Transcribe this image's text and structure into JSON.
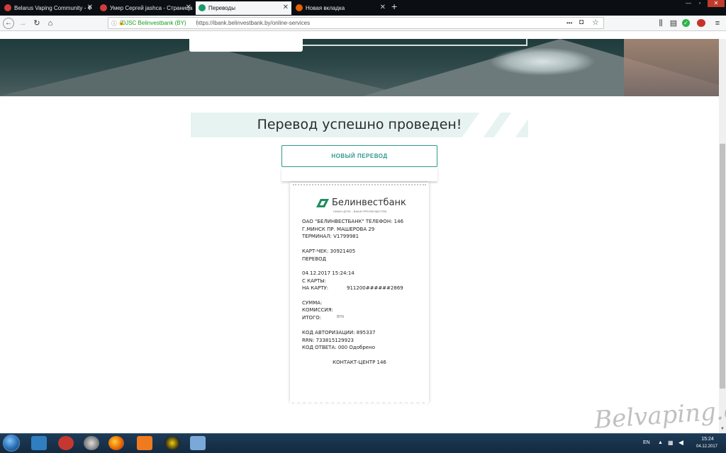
{
  "browser": {
    "tabs": [
      {
        "title": "Belarus Vaping Community - Ф",
        "icon": "globe-icon",
        "icon_color": "#d33c3c"
      },
      {
        "title": "Умер Сергей jashca - Страница",
        "icon": "globe-icon",
        "icon_color": "#d33c3c"
      },
      {
        "title": "Переводы",
        "icon": "bank-icon",
        "icon_color": "#1a9a6c",
        "active": true
      },
      {
        "title": "Новая вкладка",
        "icon": "firefox-icon",
        "icon_color": "#e66000"
      }
    ],
    "new_tab_symbol": "+",
    "url_org": "OJSC Belinvestbank (BY)",
    "url": "https://ibank.belinvestbank.by/online-services",
    "url_menu_symbol": "•••"
  },
  "page": {
    "success_title": "Перевод успешно проведен!",
    "new_transfer_label": "НОВЫЙ ПЕРЕВОД"
  },
  "receipt": {
    "bank_name": "Белинвестбанк",
    "slogan": "НАШИ ЦЕЛИ – ВАШИ ПРЕИМУЩЕСТВА",
    "lines": [
      "ОАО \"БЕЛИНВЕСТБАНК\" ТЕЛЕФОН: 146",
      "Г.МИНСК ПР. МАШЕРОВА 29",
      "ТЕРМИНАЛ: V1799981",
      "КАРТ-ЧЕК: 30921405",
      "ПЕРЕВОД",
      "04.12.2017 15:24:14",
      "С КАРТЫ:",
      "НА КАРТУ:",
      "СУММА:",
      "КОМИССИЯ:",
      "ИТОГО:",
      "КОД АВТОРИЗАЦИИ: 895337",
      "RRN: 733815129923",
      "КОД ОТВЕТА: 000 Одобрено"
    ],
    "card_to": "911200######2869",
    "partial_total": "BYN",
    "contact": "КОНТАКТ-ЦЕНТР 146"
  },
  "watermark": "Belvaping.com",
  "taskbar": {
    "lang": "EN",
    "time": "15:24",
    "date": "04.12.2017"
  },
  "colors": {
    "accent": "#2d9a8a",
    "banner": "#e6f3f1"
  }
}
